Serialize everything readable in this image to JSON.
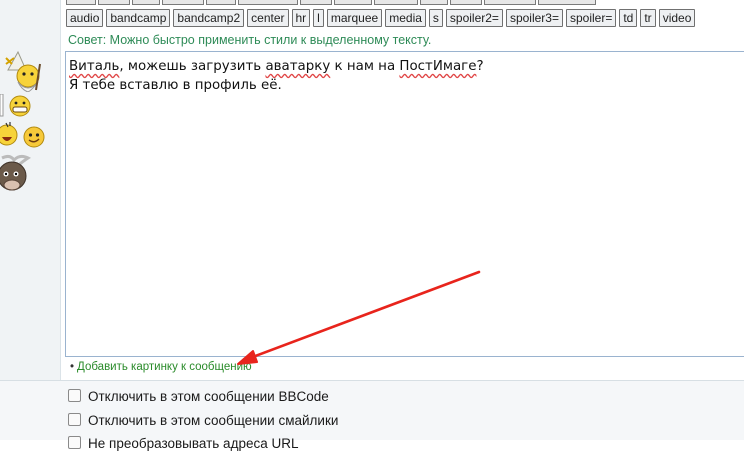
{
  "toolbar": {
    "tags": [
      "audio",
      "bandcamp",
      "bandcamp2",
      "center",
      "hr",
      "l",
      "marquee",
      "media",
      "s",
      "spoiler2=",
      "spoiler3=",
      "spoiler=",
      "td",
      "tr",
      "video"
    ]
  },
  "tip": "Совет: Можно быстро применить стили к выделенному тексту.",
  "editor": {
    "line1": {
      "w1": "Виталь",
      "t1": ", можешь загрузить ",
      "w2": "аватарку",
      "t2": " к нам на ",
      "w3": "ПостИмаге",
      "t3": "?"
    },
    "line2": "Я тебе вставлю в профиль её."
  },
  "add_image_link": "Добавить картинку к сообщению",
  "options": [
    "Отключить в этом сообщении BBCode",
    "Отключить в этом сообщении смайлики",
    "Не преобразовывать адреса URL"
  ],
  "smilies": [
    "wizard-smiley-icon",
    "grin-smiley-icon",
    "laughing-smiley-icon",
    "smiling-smiley-icon",
    "cow-smiley-icon"
  ],
  "colors": {
    "tip": "#2e8b57",
    "link": "#2a8b2a",
    "arrow": "#e8241c",
    "editor_border": "#9ab3cf"
  }
}
